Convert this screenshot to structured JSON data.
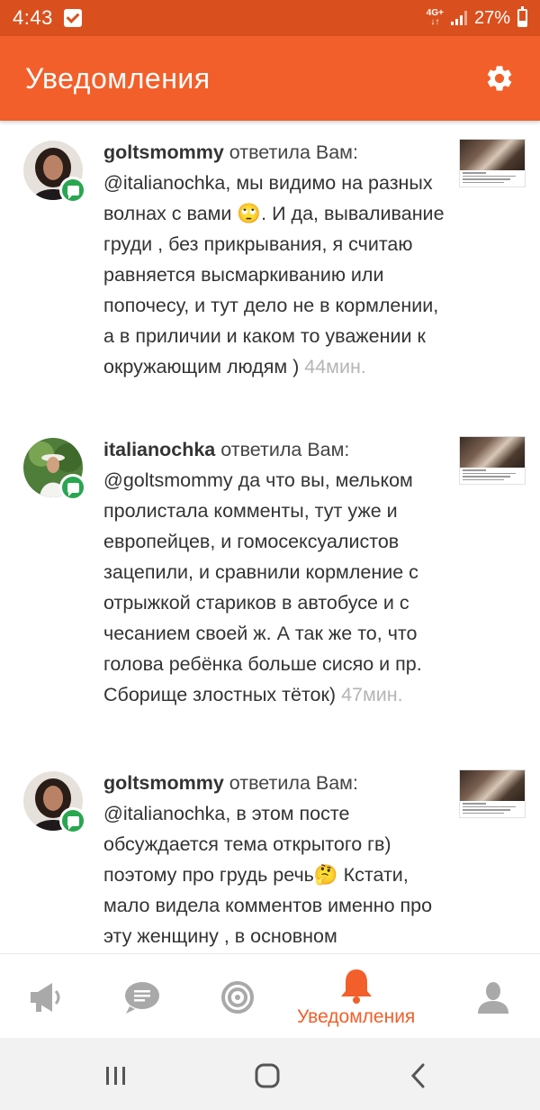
{
  "status_bar": {
    "time": "4:43",
    "network": "4G+",
    "battery": "27%"
  },
  "header": {
    "title": "Уведомления",
    "settings_icon": "gear-icon"
  },
  "notifications": [
    {
      "username": "goltsmommy",
      "action": "ответила Вам:",
      "text": "@italianochka, мы видимо на разных волнах с вами 🙄. И да, вываливание груди , без прикрывания, я считаю равняется высмаркиванию или попочесу, и тут дело не в кормлении, а в приличии и каком то уважении к окружающим людям ) ",
      "time": "44мин.",
      "badge_icon": "comment-icon"
    },
    {
      "username": "italianochka",
      "action": "ответила Вам:",
      "text": "@goltsmommy да что вы, мельком пролистала комменты, тут уже и европейцев, и гомосексуалистов зацепили, и сравнили кормление с отрыжкой стариков в автобусе и с чесанием своей ж. А так же то, что голова ребёнка больше сисяо и пр. Сборище злостных тёток) ",
      "time": "47мин.",
      "badge_icon": "comment-icon"
    },
    {
      "username": "goltsmommy",
      "action": "ответила Вам:",
      "text": "@italianochka, в этом посте обсуждается тема открытого гв) поэтому про грудь речь🤔 Кстати, мало видела комментов именно про эту женщину , в основном",
      "time": "",
      "badge_icon": "comment-icon"
    }
  ],
  "bottom_nav": {
    "items": [
      {
        "icon": "megaphone-icon",
        "label": ""
      },
      {
        "icon": "chat-icon",
        "label": ""
      },
      {
        "icon": "target-icon",
        "label": ""
      },
      {
        "icon": "bell-icon",
        "label": "Уведомления"
      },
      {
        "icon": "person-icon",
        "label": ""
      }
    ],
    "active_index": 3
  },
  "colors": {
    "accent": "#f25f2a",
    "status_bar": "#d9501e",
    "badge": "#2aa651",
    "inactive_icon": "#a9a9a9",
    "muted_time": "#b5b5b5"
  }
}
